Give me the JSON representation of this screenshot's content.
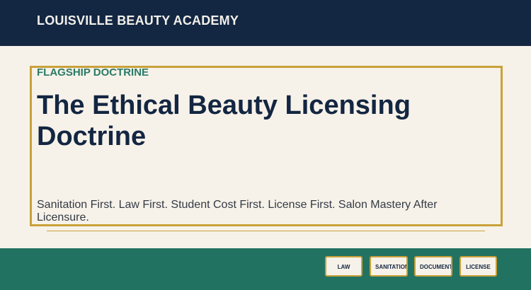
{
  "header": {
    "brand": "LOUISVILLE BEAUTY ACADEMY"
  },
  "hero": {
    "eyebrow": "FLAGSHIP DOCTRINE",
    "title": "The Ethical Beauty Licensing Doctrine",
    "tagline": "Sanitation First. Law First. Student Cost First. License First. Salon Mastery After Licensure."
  },
  "footer": {
    "buttons": [
      "LAW",
      "SANITATION",
      "DOCUMENTS",
      "LICENSE"
    ]
  },
  "colors": {
    "navy": "#132642",
    "cream": "#f7f2e9",
    "teal": "#227262",
    "gold": "#c9a13a",
    "eyebrow_green": "#2a7a68"
  }
}
